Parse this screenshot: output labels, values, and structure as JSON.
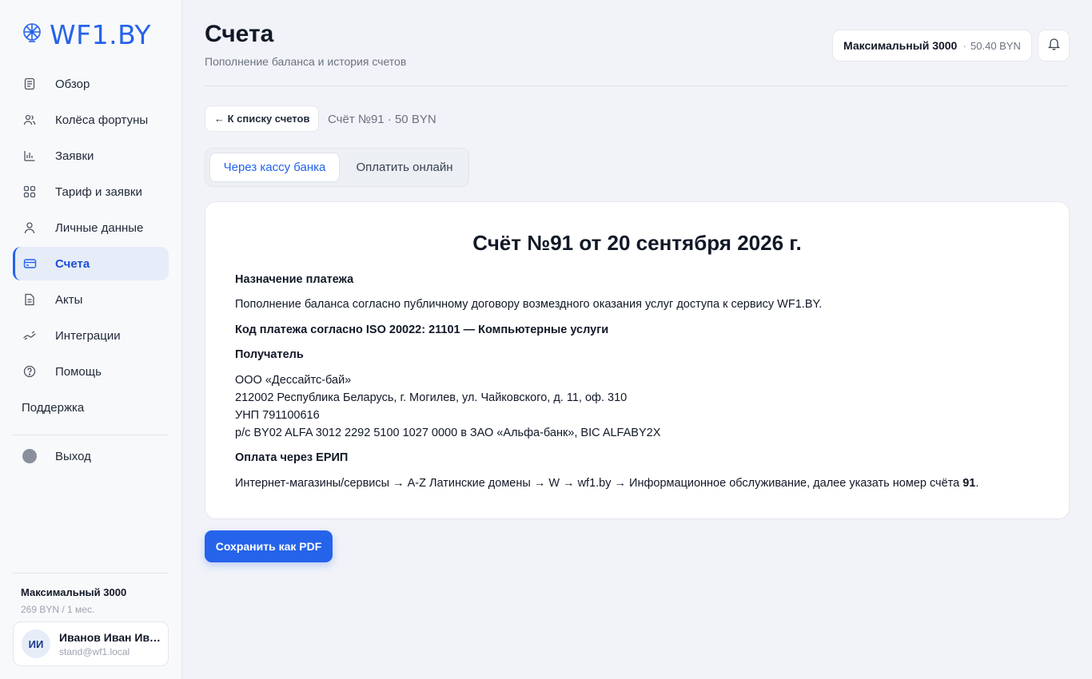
{
  "app": {
    "logo_text": "WF1.BY"
  },
  "sidebar": {
    "items": [
      {
        "label": "Обзор",
        "icon": "document-icon"
      },
      {
        "label": "Колёса фортуны",
        "icon": "users-icon"
      },
      {
        "label": "Заявки",
        "icon": "bar-chart-icon"
      },
      {
        "label": "Тариф и заявки",
        "icon": "grid-icon"
      },
      {
        "label": "Личные данные",
        "icon": "user-icon"
      },
      {
        "label": "Счета",
        "icon": "credit-card-icon",
        "active": true
      },
      {
        "label": "Акты",
        "icon": "file-icon"
      },
      {
        "label": "Интеграции",
        "icon": "link-icon"
      },
      {
        "label": "Помощь",
        "icon": "help-icon"
      }
    ],
    "support_label": "Поддержка",
    "logout_label": "Выход",
    "plan_name": "Максимальный 3000",
    "plan_price": "269 BYN / 1 мес.",
    "user": {
      "initials": "ИИ",
      "name": "Иванов Иван Ива...",
      "email": "stand@wf1.local"
    }
  },
  "header": {
    "title": "Счета",
    "subtitle": "Пополнение баланса и история счетов",
    "plan_badge_name": "Максимальный 3000",
    "plan_badge_sep": "·",
    "plan_badge_balance": "50.40 BYN"
  },
  "invoice_nav": {
    "back_label": "← К списку счетов",
    "crumb": "Счёт №91 · 50 BYN"
  },
  "tabs": [
    {
      "label": "Через кассу банка",
      "active": true
    },
    {
      "label": "Оплатить онлайн",
      "active": false
    }
  ],
  "invoice": {
    "title": "Счёт №91 от 20 сентября 2026 г.",
    "purpose_heading": "Назначение платежа",
    "purpose_text": "Пополнение баланса согласно публичному договору возмездного оказания услуг доступа к сервису WF1.BY.",
    "payment_code": "Код платежа согласно ISO 20022: 21101 — Компьютерные услуги",
    "recipient_heading": "Получатель",
    "recipient_lines": [
      "ООО «Дессайтс-бай»",
      "212002 Республика Беларусь, г. Могилев, ул. Чайковского, д. 11, оф. 310",
      "УНП 791100616",
      "р/с BY02 ALFA 3012 2292 5100 1027 0000 в ЗАО «Альфа-банк», BIC ALFABY2X"
    ],
    "erip_heading": "Оплата через ЕРИП",
    "erip_text": "Интернет-магазины/сервисы → A-Z Латинские домены → W → wf1.by → Информационное обслуживание, далее указать номер счёта ",
    "erip_number": "91",
    "erip_end": "."
  },
  "actions": {
    "save_pdf_label": "Сохранить как PDF"
  },
  "colors": {
    "accent": "#2563eb",
    "background": "#f1f3f8",
    "sidebar_active": "#e6ecf8"
  }
}
